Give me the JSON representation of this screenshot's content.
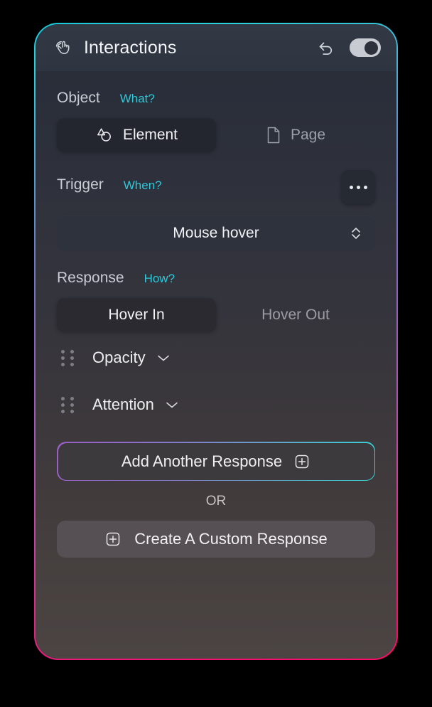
{
  "header": {
    "icon": "hand-pointer-icon",
    "title": "Interactions",
    "undo_icon": "undo-arrow-icon",
    "toggle_state": "on"
  },
  "object_section": {
    "label": "Object",
    "hint": "What?",
    "options": [
      {
        "label": "Element",
        "icon": "shapes-icon",
        "active": true
      },
      {
        "label": "Page",
        "icon": "document-icon",
        "active": false
      }
    ]
  },
  "trigger_section": {
    "label": "Trigger",
    "hint": "When?",
    "more_icon": "ellipsis-icon",
    "select": {
      "value": "Mouse hover",
      "caret_icon": "chevron-updown-icon"
    }
  },
  "response_section": {
    "label": "Response",
    "hint": "How?",
    "modes": [
      {
        "label": "Hover In",
        "active": true
      },
      {
        "label": "Hover Out",
        "active": false
      }
    ],
    "items": [
      {
        "name": "Opacity",
        "handle_icon": "drag-handle-icon",
        "caret_icon": "chevron-down-icon"
      },
      {
        "name": "Attention",
        "handle_icon": "drag-handle-icon",
        "caret_icon": "chevron-down-icon"
      }
    ],
    "add_button": {
      "label": "Add Another Response",
      "icon": "plus-box-icon"
    },
    "divider_text": "OR",
    "custom_button": {
      "label": "Create A Custom Response",
      "icon": "plus-box-icon"
    }
  },
  "colors": {
    "accent_cyan": "#2ec8d8",
    "border_gradient_start": "#18c8d8",
    "border_gradient_end": "#ff0a66",
    "panel_bg_top": "#272c38",
    "panel_bg_bottom": "#4b4443"
  }
}
